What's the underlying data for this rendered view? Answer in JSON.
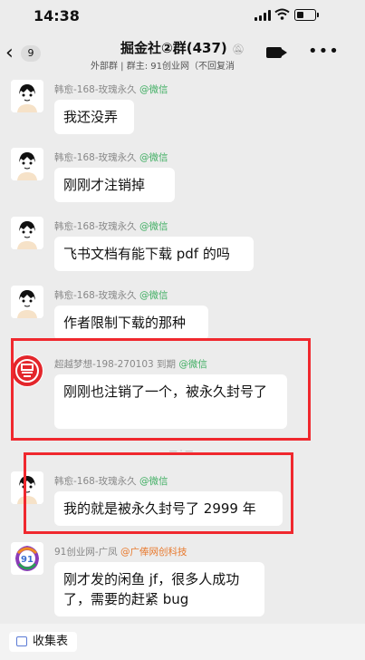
{
  "status_bar": {
    "time": "14:38"
  },
  "nav": {
    "back_count": "9",
    "title": "掘金社②群(437)",
    "subtitle": "外部群 | 群主: 91创业网（不回复消"
  },
  "messages": [
    {
      "sender": "韩愈-168-玫瑰永久",
      "source": "@微信",
      "text": "我还没弄"
    },
    {
      "sender": "韩愈-168-玫瑰永久",
      "source": "@微信",
      "text": "刚刚才注销掉"
    },
    {
      "sender": "韩愈-168-玫瑰永久",
      "source": "@微信",
      "text": "飞书文档有能下载 pdf 的吗"
    },
    {
      "sender": "韩愈-168-玫瑰永久",
      "source": "@微信",
      "text": "作者限制下载的那种"
    },
    {
      "sender": "超越梦想-198-270103 到期",
      "source": "@微信",
      "text": "刚刚也注销了一个，被永久封号了"
    },
    {
      "sender": "韩愈-168-玫瑰永久",
      "source": "@微信",
      "text": "我的就是被永久封号了 2999 年"
    },
    {
      "sender": "91创业网-广凤",
      "source": "@广俸网创科技",
      "text": "刚才发的闲鱼 jf，很多人成功了，需要的赶紧 bug",
      "avatar_text": "91"
    }
  ],
  "bottom": {
    "collect_label": "收集表"
  }
}
